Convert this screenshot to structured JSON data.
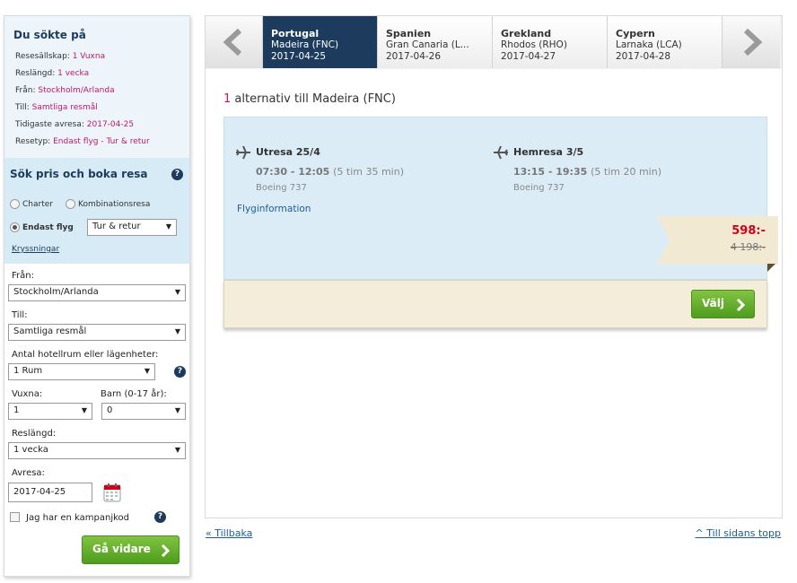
{
  "summary": {
    "title": "Du sökte på",
    "rows": [
      {
        "label": "Resesällskap:",
        "value": "1 Vuxna"
      },
      {
        "label": "Reslängd:",
        "value": "1 vecka"
      },
      {
        "label": "Från:",
        "value": "Stockholm/Arlanda"
      },
      {
        "label": "Till:",
        "value": "Samtliga resmål"
      },
      {
        "label": "Tidigaste avresa:",
        "value": "2017-04-25"
      },
      {
        "label": "Resetyp:",
        "value": "Endast flyg - Tur & retur"
      }
    ]
  },
  "search": {
    "title": "Sök pris och boka resa",
    "help": "?",
    "charter": "Charter",
    "kombination": "Kombinationsresa",
    "endast_flyg": "Endast flyg",
    "trip_type": "Tur & retur",
    "kryssningar": "Kryssningar",
    "fran_label": "Från:",
    "fran_value": "Stockholm/Arlanda",
    "till_label": "Till:",
    "till_value": "Samtliga resmål",
    "rooms_label": "Antal hotellrum eller lägenheter:",
    "rooms_value": "1 Rum",
    "vuxna_label": "Vuxna:",
    "vuxna_value": "1",
    "barn_label": "Barn (0-17 år):",
    "barn_value": "0",
    "reslangd_label": "Reslängd:",
    "reslangd_value": "1 vecka",
    "avresa_label": "Avresa:",
    "avresa_value": "2017-04-25",
    "kampanj_label": "Jag har en kampanjkod",
    "submit": "Gå vidare"
  },
  "tabs": [
    {
      "country": "Portugal",
      "dest": "Madeira (FNC)",
      "date": "2017-04-25",
      "active": true
    },
    {
      "country": "Spanien",
      "dest": "Gran Canaria (L...",
      "date": "2017-04-26"
    },
    {
      "country": "Grekland",
      "dest": "Rhodos (RHO)",
      "date": "2017-04-27"
    },
    {
      "country": "Cypern",
      "dest": "Larnaka (LCA)",
      "date": "2017-04-28"
    }
  ],
  "results": {
    "count": "1",
    "heading": "alternativ till Madeira (FNC)",
    "outbound": {
      "title": "Utresa 25/4",
      "time": "07:30 - 12:05",
      "duration": "(5 tim 35 min)",
      "plane": "Boeing 737"
    },
    "inbound": {
      "title": "Hemresa 3/5",
      "time": "13:15 - 19:35",
      "duration": "(5 tim 20 min)",
      "plane": "Boeing 737"
    },
    "flyginfo": "Flyginformation",
    "price": "598:-",
    "old_price": "4 198:-",
    "select": "Välj"
  },
  "footer": {
    "back": "« Tillbaka",
    "top": "^ Till sidans topp"
  },
  "colors": {
    "accent": "#c2186b",
    "navy": "#1d3c5d",
    "green": "#5aab25",
    "price": "#d0021b"
  }
}
